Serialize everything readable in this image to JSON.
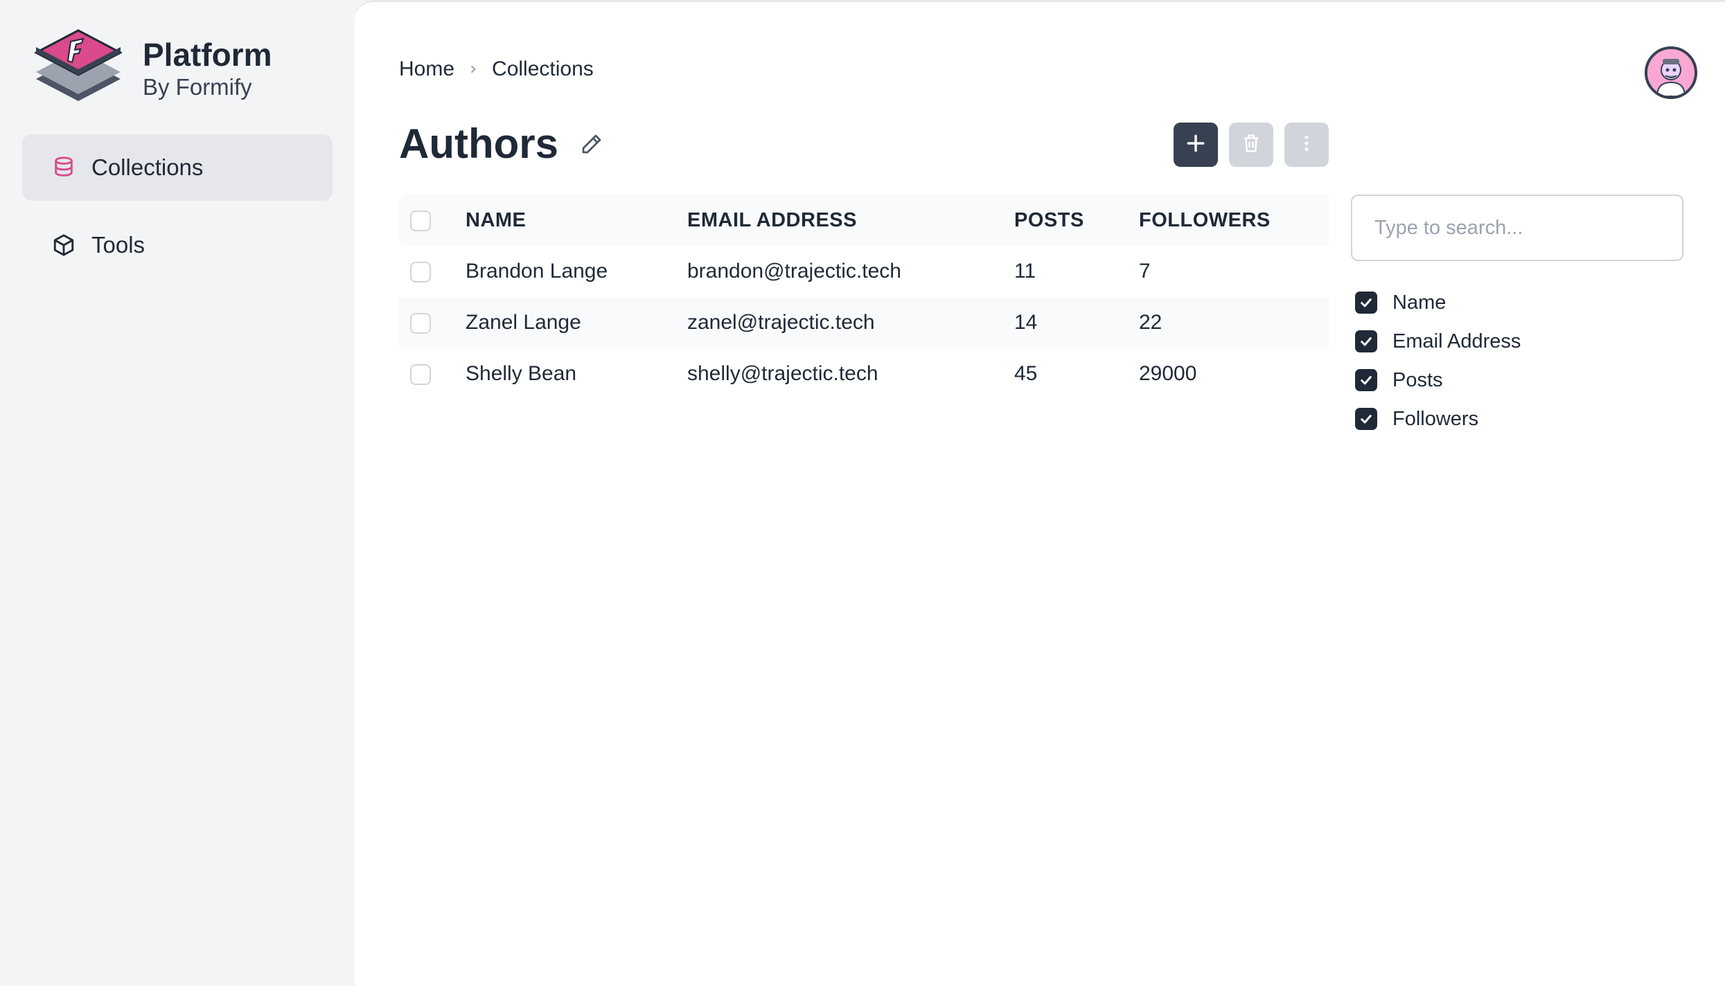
{
  "brand": {
    "title": "Platform",
    "subtitle": "By Formify",
    "logo_icon": "formify-logo-icon",
    "accent": "#db4a8b"
  },
  "sidebar": {
    "items": [
      {
        "label": "Collections",
        "icon": "database-icon",
        "active": true
      },
      {
        "label": "Tools",
        "icon": "cube-icon",
        "active": false
      }
    ]
  },
  "breadcrumb": {
    "items": [
      "Home",
      "Collections"
    ]
  },
  "page": {
    "title": "Authors"
  },
  "table": {
    "headers": [
      "NAME",
      "EMAIL ADDRESS",
      "POSTS",
      "FOLLOWERS"
    ],
    "rows": [
      {
        "name": "Brandon Lange",
        "email": "brandon@trajectic.tech",
        "posts": "11",
        "followers": "7"
      },
      {
        "name": "Zanel Lange",
        "email": "zanel@trajectic.tech",
        "posts": "14",
        "followers": "22"
      },
      {
        "name": "Shelly Bean",
        "email": "shelly@trajectic.tech",
        "posts": "45",
        "followers": "29000"
      }
    ]
  },
  "search": {
    "placeholder": "Type to search..."
  },
  "column_filters": [
    {
      "label": "Name",
      "checked": true
    },
    {
      "label": "Email Address",
      "checked": true
    },
    {
      "label": "Posts",
      "checked": true
    },
    {
      "label": "Followers",
      "checked": true
    }
  ],
  "colors": {
    "primary_button": "#374151",
    "disabled_button": "#d1d5db",
    "checkbox_checked": "#1f2937"
  }
}
